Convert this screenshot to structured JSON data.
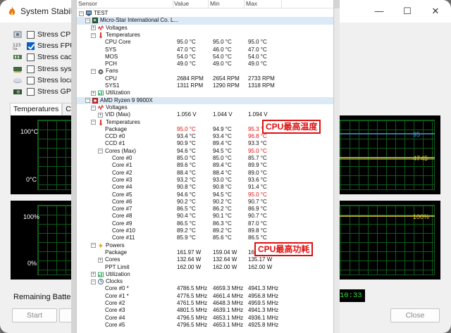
{
  "colors": {
    "highlight": "#e01010",
    "graph_green": "#0d5e18",
    "graph_bg": "#000000",
    "selection": "#dce9f6"
  },
  "bg_window": {
    "title": "System Stability",
    "controls": {
      "minimize": "—",
      "maximize": "☐",
      "close": "✕"
    },
    "stress_items": [
      {
        "label": "Stress CPU",
        "checked": false,
        "icon": "cpu-icon"
      },
      {
        "label": "Stress FPU",
        "checked": true,
        "icon": "fpu-icon"
      },
      {
        "label": "Stress cache",
        "checked": false,
        "icon": "cache-icon"
      },
      {
        "label": "Stress syste",
        "checked": false,
        "icon": "memory-icon"
      },
      {
        "label": "Stress local",
        "checked": false,
        "icon": "disk-icon"
      },
      {
        "label": "Stress GPU(",
        "checked": false,
        "icon": "gpu-icon"
      }
    ],
    "tabs": [
      "Temperatures",
      "Cool"
    ],
    "temp_graph": {
      "y_top": "100°C",
      "y_bottom": "0°C",
      "right_labels": [
        "95",
        "47",
        "45"
      ]
    },
    "util_graph": {
      "y_top": "100%",
      "y_bottom": "0%",
      "right_label": "100%"
    },
    "remaining_battery_label": "Remaining Battery:",
    "elapsed_time": "10:33",
    "start_button": "Start",
    "close_button": "Close"
  },
  "sensor_window": {
    "columns": {
      "sensor": "Sensor",
      "current": "Value",
      "minimum": "Min",
      "maximum": "Max"
    },
    "rows": [
      {
        "indent": 0,
        "type": "computer",
        "expander": "−",
        "name": "TEST",
        "v": [
          "",
          "",
          ""
        ],
        "hl": false
      },
      {
        "indent": 1,
        "type": "board",
        "expander": "−",
        "name": "Micro-Star International Co. L...",
        "v": [
          "",
          "",
          ""
        ],
        "hl": true
      },
      {
        "indent": 2,
        "type": "volt",
        "expander": "+",
        "name": "Voltages",
        "v": [
          "",
          "",
          ""
        ],
        "hl": false
      },
      {
        "indent": 2,
        "type": "temp",
        "expander": "−",
        "name": "Temperatures",
        "v": [
          "",
          "",
          ""
        ],
        "hl": false
      },
      {
        "indent": 3,
        "type": "leaf",
        "expander": "",
        "name": "CPU Core",
        "v": [
          "95.0 °C",
          "95.0 °C",
          "95.0 °C"
        ],
        "hl": false
      },
      {
        "indent": 3,
        "type": "leaf",
        "expander": "",
        "name": "SYS",
        "v": [
          "47.0 °C",
          "46.0 °C",
          "47.0 °C"
        ],
        "hl": false
      },
      {
        "indent": 3,
        "type": "leaf",
        "expander": "",
        "name": "MOS",
        "v": [
          "54.0 °C",
          "54.0 °C",
          "54.0 °C"
        ],
        "hl": false
      },
      {
        "indent": 3,
        "type": "leaf",
        "expander": "",
        "name": "PCH",
        "v": [
          "49.0 °C",
          "49.0 °C",
          "49.0 °C"
        ],
        "hl": false
      },
      {
        "indent": 2,
        "type": "fan",
        "expander": "−",
        "name": "Fans",
        "v": [
          "",
          "",
          ""
        ],
        "hl": false
      },
      {
        "indent": 3,
        "type": "leaf",
        "expander": "",
        "name": "CPU",
        "v": [
          "2684 RPM",
          "2654 RPM",
          "2733 RPM"
        ],
        "hl": false
      },
      {
        "indent": 3,
        "type": "leaf",
        "expander": "",
        "name": "SYS1",
        "v": [
          "1311 RPM",
          "1290 RPM",
          "1318 RPM"
        ],
        "hl": false
      },
      {
        "indent": 2,
        "type": "util",
        "expander": "+",
        "name": "Utilization",
        "v": [
          "",
          "",
          ""
        ],
        "hl": false
      },
      {
        "indent": 1,
        "type": "cpu",
        "expander": "−",
        "name": "AMD Ryzen 9 9900X",
        "v": [
          "",
          "",
          ""
        ],
        "hl": true
      },
      {
        "indent": 2,
        "type": "volt",
        "expander": "−",
        "name": "Voltages",
        "v": [
          "",
          "",
          ""
        ],
        "hl": false
      },
      {
        "indent": 3,
        "type": "leaf",
        "expander": "+",
        "name": "VID (Max)",
        "v": [
          "1.056 V",
          "1.044 V",
          "1.094 V"
        ],
        "hl": false
      },
      {
        "indent": 2,
        "type": "temp",
        "expander": "−",
        "name": "Temperatures",
        "v": [
          "",
          "",
          ""
        ],
        "hl": false
      },
      {
        "indent": 3,
        "type": "leaf",
        "expander": "",
        "name": "Package",
        "v": [
          "95.0 °C",
          "94.9 °C",
          "95.3 °C"
        ],
        "red": [
          true,
          false,
          true
        ],
        "hl": false
      },
      {
        "indent": 3,
        "type": "leaf",
        "expander": "",
        "name": "CCD #0",
        "v": [
          "93.4 °C",
          "93.4 °C",
          "96.8 °C"
        ],
        "red": [
          false,
          false,
          true
        ],
        "hl": false
      },
      {
        "indent": 3,
        "type": "leaf",
        "expander": "",
        "name": "CCD #1",
        "v": [
          "90.9 °C",
          "89.4 °C",
          "93.3 °C"
        ],
        "hl": false
      },
      {
        "indent": 3,
        "type": "leaf",
        "expander": "−",
        "name": "Cores (Max)",
        "v": [
          "94.6 °C",
          "94.5 °C",
          "95.0 °C"
        ],
        "red": [
          false,
          false,
          true
        ],
        "hl": false
      },
      {
        "indent": 4,
        "type": "leaf",
        "expander": "",
        "name": "Core #0",
        "v": [
          "85.0 °C",
          "85.0 °C",
          "85.7 °C"
        ],
        "hl": false
      },
      {
        "indent": 4,
        "type": "leaf",
        "expander": "",
        "name": "Core #1",
        "v": [
          "89.6 °C",
          "89.4 °C",
          "89.9 °C"
        ],
        "hl": false
      },
      {
        "indent": 4,
        "type": "leaf",
        "expander": "",
        "name": "Core #2",
        "v": [
          "88.4 °C",
          "88.4 °C",
          "89.0 °C"
        ],
        "hl": false
      },
      {
        "indent": 4,
        "type": "leaf",
        "expander": "",
        "name": "Core #3",
        "v": [
          "93.2 °C",
          "93.0 °C",
          "93.6 °C"
        ],
        "hl": false
      },
      {
        "indent": 4,
        "type": "leaf",
        "expander": "",
        "name": "Core #4",
        "v": [
          "90.8 °C",
          "90.8 °C",
          "91.4 °C"
        ],
        "hl": false
      },
      {
        "indent": 4,
        "type": "leaf",
        "expander": "",
        "name": "Core #5",
        "v": [
          "94.6 °C",
          "94.5 °C",
          "95.0 °C"
        ],
        "red": [
          false,
          false,
          true
        ],
        "hl": false
      },
      {
        "indent": 4,
        "type": "leaf",
        "expander": "",
        "name": "Core #6",
        "v": [
          "90.2 °C",
          "90.2 °C",
          "90.7 °C"
        ],
        "hl": false
      },
      {
        "indent": 4,
        "type": "leaf",
        "expander": "",
        "name": "Core #7",
        "v": [
          "86.5 °C",
          "86.2 °C",
          "86.9 °C"
        ],
        "hl": false
      },
      {
        "indent": 4,
        "type": "leaf",
        "expander": "",
        "name": "Core #8",
        "v": [
          "90.4 °C",
          "90.1 °C",
          "90.7 °C"
        ],
        "hl": false
      },
      {
        "indent": 4,
        "type": "leaf",
        "expander": "",
        "name": "Core #9",
        "v": [
          "86.5 °C",
          "86.3 °C",
          "87.0 °C"
        ],
        "hl": false
      },
      {
        "indent": 4,
        "type": "leaf",
        "expander": "",
        "name": "Core #10",
        "v": [
          "89.2 °C",
          "89.2 °C",
          "89.8 °C"
        ],
        "hl": false
      },
      {
        "indent": 4,
        "type": "leaf",
        "expander": "",
        "name": "Core #11",
        "v": [
          "85.9 °C",
          "85.6 °C",
          "86.5 °C"
        ],
        "hl": false
      },
      {
        "indent": 2,
        "type": "power",
        "expander": "−",
        "name": "Powers",
        "v": [
          "",
          "",
          ""
        ],
        "hl": false
      },
      {
        "indent": 3,
        "type": "leaf",
        "expander": "",
        "name": "Package",
        "v": [
          "161.97 W",
          "159.04 W",
          "162.34 W"
        ],
        "hl": false
      },
      {
        "indent": 3,
        "type": "leaf",
        "expander": "+",
        "name": "Cores",
        "v": [
          "132.64 W",
          "132.64 W",
          "135.17 W"
        ],
        "hl": false
      },
      {
        "indent": 3,
        "type": "leaf",
        "expander": "",
        "name": "PPT Limit",
        "v": [
          "162.00 W",
          "162.00 W",
          "162.00 W"
        ],
        "hl": false
      },
      {
        "indent": 2,
        "type": "util",
        "expander": "+",
        "name": "Utilization",
        "v": [
          "",
          "",
          ""
        ],
        "hl": false
      },
      {
        "indent": 2,
        "type": "clock",
        "expander": "−",
        "name": "Clocks",
        "v": [
          "",
          "",
          ""
        ],
        "hl": false
      },
      {
        "indent": 3,
        "type": "leaf",
        "expander": "",
        "name": "Core #0 *",
        "v": [
          "4786.5 MHz",
          "4659.3 MHz",
          "4941.3 MHz"
        ],
        "hl": false
      },
      {
        "indent": 3,
        "type": "leaf",
        "expander": "",
        "name": "Core #1 *",
        "v": [
          "4776.5 MHz",
          "4661.4 MHz",
          "4956.8 MHz"
        ],
        "hl": false
      },
      {
        "indent": 3,
        "type": "leaf",
        "expander": "",
        "name": "Core #2",
        "v": [
          "4761.5 MHz",
          "4648.3 MHz",
          "4959.5 MHz"
        ],
        "hl": false
      },
      {
        "indent": 3,
        "type": "leaf",
        "expander": "",
        "name": "Core #3",
        "v": [
          "4801.5 MHz",
          "4639.1 MHz",
          "4941.3 MHz"
        ],
        "hl": false
      },
      {
        "indent": 3,
        "type": "leaf",
        "expander": "",
        "name": "Core #4",
        "v": [
          "4796.5 MHz",
          "4653.1 MHz",
          "4936.1 MHz"
        ],
        "hl": false
      },
      {
        "indent": 3,
        "type": "leaf",
        "expander": "",
        "name": "Core #5",
        "v": [
          "4796.5 MHz",
          "4653.1 MHz",
          "4925.8 MHz"
        ],
        "hl": false
      }
    ]
  },
  "annotations": {
    "cpu_max_temp": "CPU最高温度",
    "cpu_max_power": "CPU最高功耗"
  }
}
